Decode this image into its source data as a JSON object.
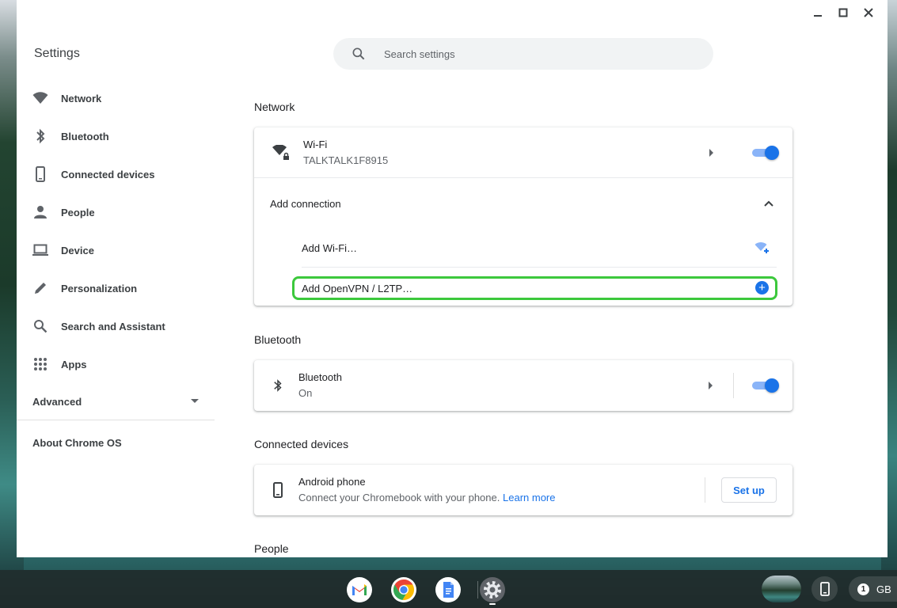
{
  "window": {
    "title": "Settings",
    "controls": [
      "minimize",
      "maximize",
      "close"
    ]
  },
  "search": {
    "placeholder": "Search settings",
    "value": ""
  },
  "sidebar": {
    "items": [
      {
        "label": "Network",
        "icon": "wifi-icon"
      },
      {
        "label": "Bluetooth",
        "icon": "bluetooth-icon"
      },
      {
        "label": "Connected devices",
        "icon": "phone-icon"
      },
      {
        "label": "People",
        "icon": "person-icon"
      },
      {
        "label": "Device",
        "icon": "laptop-icon"
      },
      {
        "label": "Personalization",
        "icon": "pen-icon"
      },
      {
        "label": "Search and Assistant",
        "icon": "search-icon"
      },
      {
        "label": "Apps",
        "icon": "apps-grid-icon"
      }
    ],
    "advanced": "Advanced",
    "about": "About Chrome OS"
  },
  "network": {
    "title": "Network",
    "wifi": {
      "label": "Wi-Fi",
      "ssid": "TALKTALK1F8915",
      "enabled": true
    },
    "add_connection": {
      "label": "Add connection",
      "expanded": true,
      "items": [
        {
          "label": "Add Wi-Fi…",
          "icon": "wifi-add-icon"
        },
        {
          "label": "Add OpenVPN / L2TP…",
          "icon": "add-circle-icon",
          "highlighted": true
        }
      ]
    }
  },
  "bluetooth": {
    "title": "Bluetooth",
    "label": "Bluetooth",
    "status": "On",
    "enabled": true
  },
  "connected_devices": {
    "title": "Connected devices",
    "android_phone": {
      "label": "Android phone",
      "description": "Connect your Chromebook with your phone.",
      "link": "Learn more",
      "button": "Set up"
    }
  },
  "people": {
    "title": "People"
  },
  "shelf": {
    "apps": [
      "gmail-icon",
      "chrome-icon",
      "docs-icon",
      "settings-icon"
    ],
    "tray": {
      "notification_count": "1",
      "label": "GB"
    }
  },
  "colors": {
    "accent": "#1a73e8",
    "highlight": "#3cc83c"
  }
}
